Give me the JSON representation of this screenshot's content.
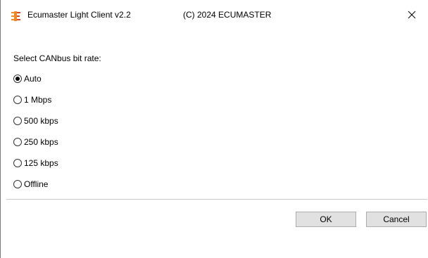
{
  "window": {
    "title": "Ecumaster Light Client v2.2",
    "copyright": "(C) 2024 ECUMASTER",
    "close_glyph": "✕",
    "icon": "ecumaster-logo-icon",
    "icon_color": "#f08a24"
  },
  "dialog": {
    "prompt": "Select CANbus bit rate:",
    "options": [
      {
        "label": "Auto",
        "selected": true
      },
      {
        "label": "1 Mbps",
        "selected": false
      },
      {
        "label": "500 kbps",
        "selected": false
      },
      {
        "label": "250 kbps",
        "selected": false
      },
      {
        "label": "125 kbps",
        "selected": false
      },
      {
        "label": "Offline",
        "selected": false
      }
    ]
  },
  "buttons": {
    "ok_label": "OK",
    "cancel_label": "Cancel"
  }
}
